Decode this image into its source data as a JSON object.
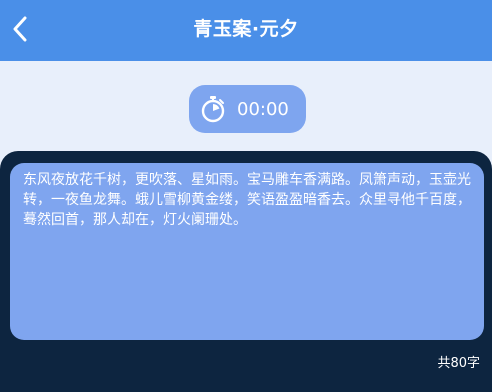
{
  "header": {
    "title": "青玉案·元夕",
    "back_icon": "chevron-left-icon",
    "background": "#4a8fe8"
  },
  "timer": {
    "icon": "stopwatch-icon",
    "time": "00:00",
    "background": "#7ea5ef"
  },
  "poem": {
    "text": "东风夜放花千树，更吹落、星如雨。宝马雕车香满路。凤箫声动，玉壶光转，一夜鱼龙舞。蛾儿雪柳黄金缕，笑语盈盈暗香去。众里寻他千百度，蓦然回首，那人却在，灯火阑珊处。",
    "char_count": "共80字",
    "box_color": "#7fa5ef",
    "panel_color": "#0d2540"
  }
}
